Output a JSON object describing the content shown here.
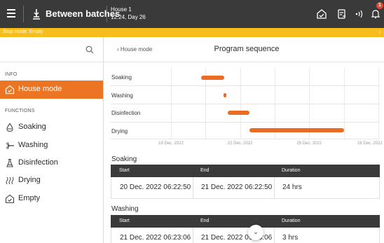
{
  "header": {
    "title": "Between batches",
    "house_line1": "House 1",
    "house_line2": "12:24, Day 26",
    "notification_count": "1"
  },
  "banner": {
    "text": "Stop mode: Empty",
    "chevron": "›",
    "color": "#f6bd1c"
  },
  "sidebar": {
    "info_label": "INFO",
    "functions_label": "FUNCTIONS",
    "items": [
      {
        "label": "House mode",
        "icon": "house-icon",
        "active": true
      },
      {
        "label": "Soaking",
        "icon": "droplet-icon"
      },
      {
        "label": "Washing",
        "icon": "washing-icon"
      },
      {
        "label": "Disinfection",
        "icon": "flask-icon"
      },
      {
        "label": "Drying",
        "icon": "heat-icon"
      },
      {
        "label": "Empty",
        "icon": "house-empty-icon"
      }
    ]
  },
  "main": {
    "back_label": "‹  House mode",
    "title": "Program sequence"
  },
  "chart_data": {
    "type": "gantt",
    "rows": [
      "Soaking",
      "Washing",
      "Disinfection",
      "Drying"
    ],
    "x_ticks": [
      "19 Dec. 2022",
      "22 Dec. 2022",
      "25 Dec. 2022",
      "28 Dec. 2022"
    ],
    "bar_color": "#ea6b24",
    "bars": [
      {
        "row": "Soaking",
        "start_day": 20.3,
        "end_day": 21.3
      },
      {
        "row": "Washing",
        "start_day": 21.27,
        "end_day": 21.4
      },
      {
        "row": "Disinfection",
        "start_day": 21.45,
        "end_day": 22.4
      },
      {
        "row": "Drying",
        "start_day": 22.4,
        "end_day": 26.5
      }
    ],
    "x_range": [
      19,
      28
    ]
  },
  "sections": [
    {
      "title": "Soaking",
      "headers": [
        "Start",
        "End",
        "Duration"
      ],
      "row": [
        "20 Dec. 2022 06:22:50",
        "21 Dec. 2022 06:22:50",
        "24 hrs"
      ]
    },
    {
      "title": "Washing",
      "headers": [
        "Start",
        "End",
        "Duration"
      ],
      "row": [
        "21 Dec. 2022 06:23:06",
        "21 Dec. 2022 09:23:06",
        "3 hrs"
      ]
    }
  ],
  "scroll_glyph": "⌄",
  "accent": "#ec7524"
}
